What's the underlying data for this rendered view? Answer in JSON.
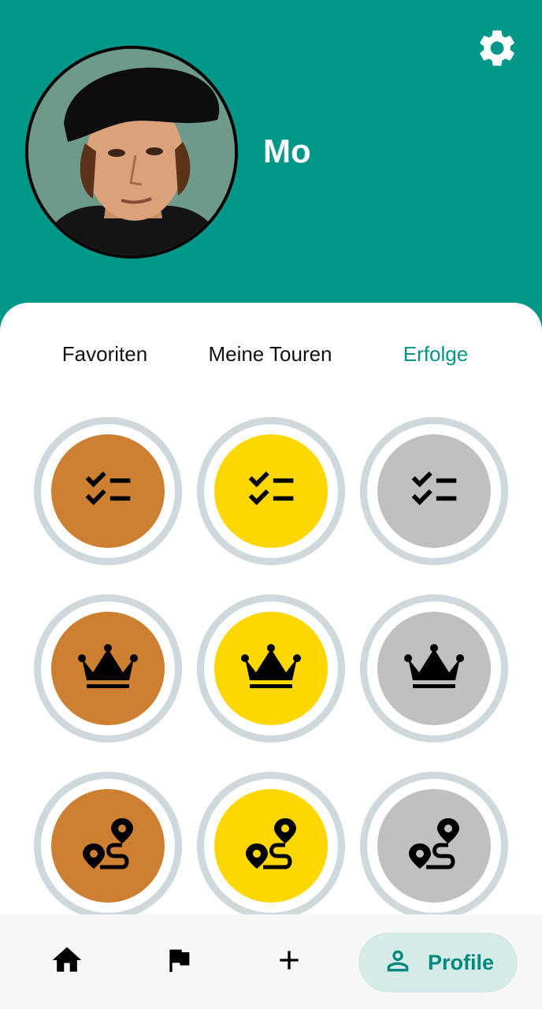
{
  "profile": {
    "name": "Mo",
    "avatar_alt": "portrait"
  },
  "tabs": [
    {
      "label": "Favoriten",
      "active": false
    },
    {
      "label": "Meine Touren",
      "active": false
    },
    {
      "label": "Erfolge",
      "active": true
    }
  ],
  "achievements": [
    {
      "icon": "checklist-icon",
      "tier": "bronze",
      "color": "#cd7f32"
    },
    {
      "icon": "checklist-icon",
      "tier": "gold",
      "color": "#ffd700"
    },
    {
      "icon": "checklist-icon",
      "tier": "silver",
      "color": "#c0c0c0"
    },
    {
      "icon": "crown-icon",
      "tier": "bronze",
      "color": "#cd7f32"
    },
    {
      "icon": "crown-icon",
      "tier": "gold",
      "color": "#ffd700"
    },
    {
      "icon": "crown-icon",
      "tier": "silver",
      "color": "#c0c0c0"
    },
    {
      "icon": "route-icon",
      "tier": "bronze",
      "color": "#cd7f32"
    },
    {
      "icon": "route-icon",
      "tier": "gold",
      "color": "#ffd700"
    },
    {
      "icon": "route-icon",
      "tier": "silver",
      "color": "#c0c0c0"
    }
  ],
  "bottom_nav": {
    "items": [
      {
        "icon": "home-icon"
      },
      {
        "icon": "flag-icon"
      },
      {
        "icon": "plus-icon"
      }
    ],
    "active": {
      "icon": "person-icon",
      "label": "Profile"
    }
  },
  "colors": {
    "primary": "#009688",
    "active_tab": "#009688",
    "badge_ring": "#cfd8dc",
    "nav_pill": "#d4ebe8"
  }
}
